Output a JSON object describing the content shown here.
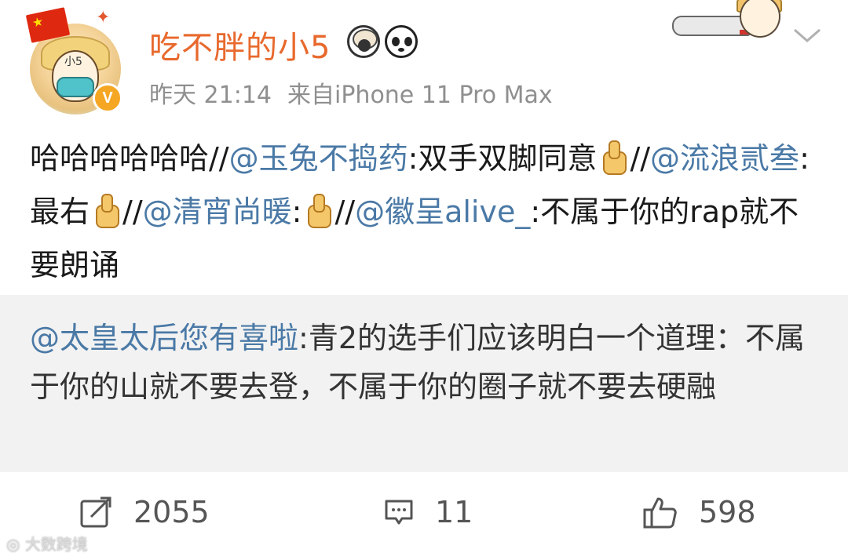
{
  "user": {
    "name": "吃不胖的小5",
    "time": "昨天 21:14",
    "source": "来自iPhone 11 Pro Max",
    "avatar_tag": "小5",
    "verified_badge": "V"
  },
  "post": {
    "segments": [
      {
        "text": "哈哈哈哈哈哈//",
        "type": "text"
      },
      {
        "text": "@玉兔不捣药",
        "type": "mention"
      },
      {
        "text": ":双手双脚同意",
        "type": "text"
      },
      {
        "type": "emoji",
        "name": "thumbs-up"
      },
      {
        "text": "//",
        "type": "text"
      },
      {
        "text": "@流浪贰叁",
        "type": "mention"
      },
      {
        "text": ":最右",
        "type": "text"
      },
      {
        "type": "emoji",
        "name": "thumbs-up"
      },
      {
        "text": "//",
        "type": "text"
      },
      {
        "text": "@清宵尚暖",
        "type": "mention"
      },
      {
        "text": ":",
        "type": "text"
      },
      {
        "type": "emoji",
        "name": "thumbs-up"
      },
      {
        "text": "//",
        "type": "text"
      },
      {
        "text": "@徽呈alive_",
        "type": "mention"
      },
      {
        "text": ":不属于你的rap就不要朗诵",
        "type": "text"
      }
    ]
  },
  "quote": {
    "author": "@太皇太后您有喜啦",
    "text": ":青2的选手们应该明白一个道理：不属于你的山就不要去登，不属于你的圈子就不要去硬融"
  },
  "actions": {
    "repost_count": "2055",
    "comment_count": "11",
    "like_count": "598"
  },
  "watermark": "大数跨境",
  "colors": {
    "username": "#e8692d",
    "mention": "#4a79a6",
    "meta": "#8f8f8f",
    "quote_bg": "#f2f2f2"
  },
  "icons": [
    "china-flag-icon",
    "sheep-badge-icon",
    "panda-badge-icon",
    "chevron-down-icon",
    "thumbs-up-emoji",
    "repost-icon",
    "comment-icon",
    "like-icon"
  ]
}
